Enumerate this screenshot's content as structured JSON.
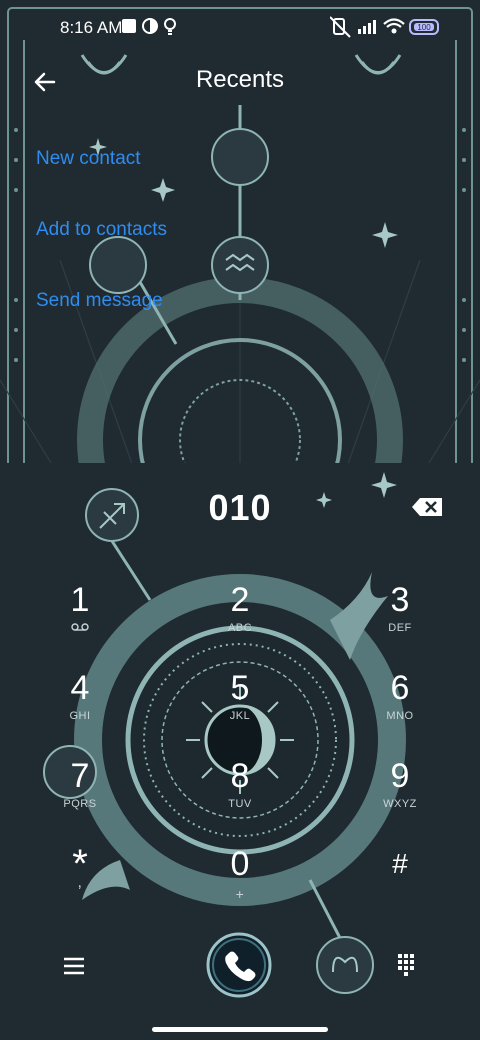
{
  "status_bar": {
    "time": "8:16 AM",
    "left_icons": [
      "square-icon",
      "theme-circle-icon",
      "bulb-icon"
    ],
    "right_icons": [
      "vibrate-off-icon",
      "signal-icon",
      "wifi-icon",
      "battery-icon"
    ],
    "battery_level": "100"
  },
  "header": {
    "title": "Recents",
    "back_icon": "back-arrow-icon"
  },
  "actions": {
    "new_contact": "New contact",
    "add_to_contacts": "Add to contacts",
    "send_message": "Send message"
  },
  "colors": {
    "background": "#1f2b31",
    "ornament": "#8fb4b4",
    "link": "#2f8cf0",
    "call_button": "#10202a"
  },
  "dialer": {
    "number": "010",
    "backspace_icon": "backspace-icon",
    "keys": [
      {
        "digit": "1",
        "letters": "∞"
      },
      {
        "digit": "2",
        "letters": "ABC"
      },
      {
        "digit": "3",
        "letters": "DEF"
      },
      {
        "digit": "4",
        "letters": "GHI"
      },
      {
        "digit": "5",
        "letters": "JKL"
      },
      {
        "digit": "6",
        "letters": "MNO"
      },
      {
        "digit": "7",
        "letters": "PQRS"
      },
      {
        "digit": "8",
        "letters": "TUV"
      },
      {
        "digit": "9",
        "letters": "WXYZ"
      },
      {
        "digit": "*",
        "letters": ","
      },
      {
        "digit": "0",
        "letters": "+"
      },
      {
        "digit": "#",
        "letters": ""
      }
    ]
  },
  "bottom_bar": {
    "menu_icon": "menu-icon",
    "call_icon": "phone-icon",
    "keypad_icon": "dialpad-icon"
  }
}
